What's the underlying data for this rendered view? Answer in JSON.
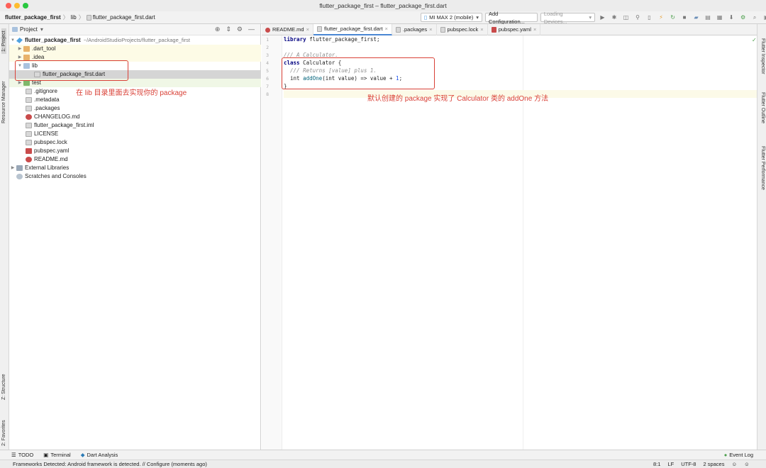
{
  "window": {
    "title": "flutter_package_first – flutter_package_first.dart"
  },
  "breadcrumb": {
    "project": "flutter_package_first",
    "folder": "lib",
    "file": "flutter_package_first.dart"
  },
  "toolbar": {
    "device": "MI MAX 2 (mobile)",
    "add_config": "Add Configuration...",
    "loading_devices": "Loading Devices..."
  },
  "left_strip": {
    "project": "1: Project",
    "resource_manager": "Resource Manager",
    "structure": "Z: Structure",
    "favorites": "2: Favorites"
  },
  "right_strip": {
    "inspector": "Flutter Inspector",
    "outline": "Flutter Outline",
    "performance": "Flutter Performance"
  },
  "project_panel": {
    "title": "Project",
    "root_name": "flutter_package_first",
    "root_path": "~/AndroidStudioProjects/flutter_package_first",
    "items": [
      {
        "label": ".dart_tool"
      },
      {
        "label": ".idea"
      },
      {
        "label": "lib"
      },
      {
        "label": "flutter_package_first.dart"
      },
      {
        "label": "test"
      },
      {
        "label": ".gitignore"
      },
      {
        "label": ".metadata"
      },
      {
        "label": ".packages"
      },
      {
        "label": "CHANGELOG.md"
      },
      {
        "label": "flutter_package_first.iml"
      },
      {
        "label": "LICENSE"
      },
      {
        "label": "pubspec.lock"
      },
      {
        "label": "pubspec.yaml"
      },
      {
        "label": "README.md"
      },
      {
        "label": "External Libraries"
      },
      {
        "label": "Scratches and Consoles"
      }
    ]
  },
  "editor_tabs": [
    {
      "label": "README.md"
    },
    {
      "label": "flutter_package_first.dart"
    },
    {
      "label": ".packages"
    },
    {
      "label": "pubspec.lock"
    },
    {
      "label": "pubspec.yaml"
    }
  ],
  "code": {
    "line_numbers": [
      "1",
      "2",
      "3",
      "4",
      "5",
      "6",
      "7",
      "8"
    ],
    "l1_kw": "library",
    "l1_rest": " flutter_package_first;",
    "l3": "/// A Calculator.",
    "l4_kw": "class",
    "l4_rest": " Calculator {",
    "l5": "  /// Returns [value] plus 1.",
    "l6_a": "  int ",
    "l6_fn": "addOne",
    "l6_b": "(int value) => value + ",
    "l6_num": "1",
    "l6_c": ";",
    "l7": "}"
  },
  "annotations": {
    "tree_note": "在 lib 目录里面去实现你的 package",
    "code_note": "默认创建的 package 实现了 Calculator 类的 addOne 方法"
  },
  "bottom_tools": {
    "todo": "TODO",
    "terminal": "Terminal",
    "dart_analysis": "Dart Analysis",
    "event_log": "Event Log"
  },
  "status": {
    "message": "Frameworks Detected: Android framework is detected. // Configure (moments ago)",
    "position": "8:1",
    "line_sep": "LF",
    "encoding": "UTF-8",
    "indent": "2 spaces"
  },
  "colors": {
    "annotation_red": "#d94137",
    "accent_blue": "#4a87d4"
  }
}
